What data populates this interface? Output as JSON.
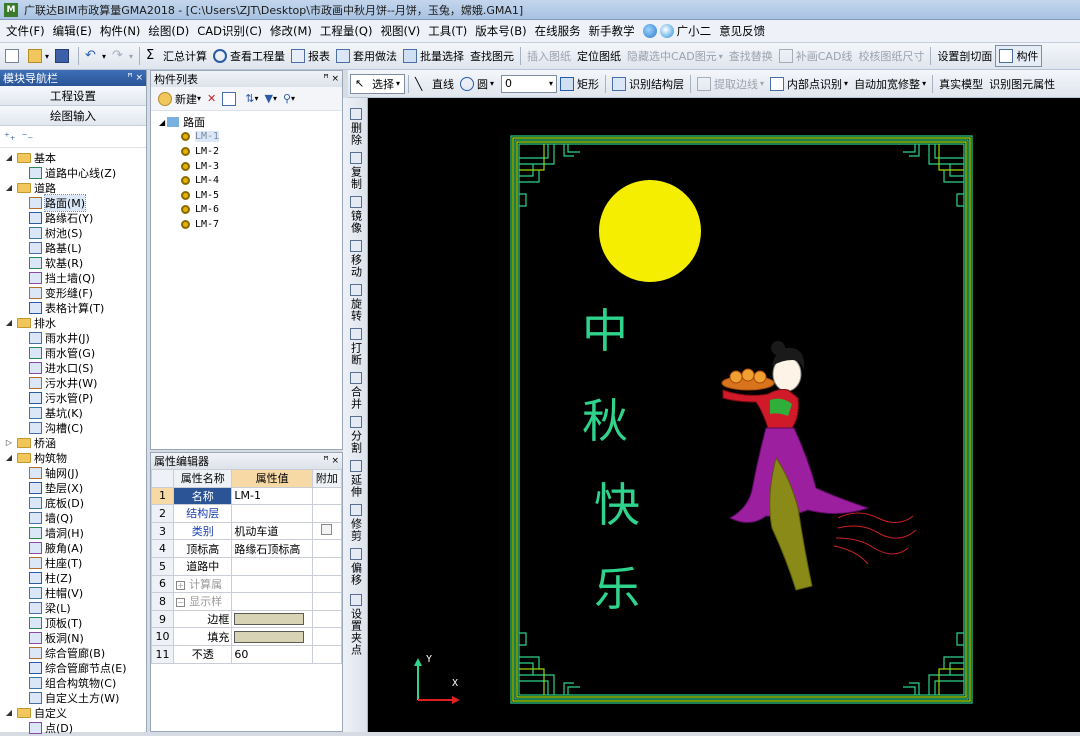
{
  "titlebar": {
    "icon_text": "M",
    "title": "广联达BIM市政算量GMA2018 - [C:\\Users\\ZJT\\Desktop\\市政画中秋月饼--月饼，玉兔，嫦娥.GMA1]"
  },
  "menubar": {
    "items": [
      "文件(F)",
      "编辑(E)",
      "构件(N)",
      "绘图(D)",
      "CAD识别(C)",
      "修改(M)",
      "工程量(Q)",
      "视图(V)",
      "工具(T)",
      "版本号(B)",
      "在线服务",
      "新手教学",
      "广小二",
      "意见反馈"
    ]
  },
  "toolbar1": {
    "summary": "汇总计算",
    "view_qty": "查看工程量",
    "report": "报表",
    "apply_method": "套用做法",
    "batch_select": "批量选择",
    "find_element": "查找图元",
    "insert_drawing": "插入图纸",
    "locate_drawing": "定位图纸",
    "hide_cad": "隐藏选中CAD图元",
    "find_replace": "查找替换",
    "fill_cad_line": "补画CAD线",
    "calibrate_size": "校核图纸尺寸",
    "set_section": "设置剖切面",
    "component": "构件"
  },
  "toolbar2": {
    "select": "选择",
    "line": "直线",
    "circle": "圆",
    "angle_value": "0",
    "rect": "矩形",
    "identify_structure": "识别结构层",
    "extract_edge": "提取边线",
    "inner_point_identify": "内部点识别",
    "auto_widen": "自动加宽修整",
    "real_model": "真实模型",
    "identify_props": "识别图元属性"
  },
  "left_panel": {
    "header": "模块导航栏",
    "pin": "ꟸ ×",
    "btn_project": "工程设置",
    "btn_draw": "绘图输入",
    "tree": [
      {
        "type": "folder",
        "label": "基本",
        "level": 0
      },
      {
        "type": "leaf",
        "label": "道路中心线(Z)",
        "level": 1
      },
      {
        "type": "folder",
        "label": "道路",
        "level": 0
      },
      {
        "type": "leaf",
        "label": "路面(M)",
        "level": 1,
        "selected": true
      },
      {
        "type": "leaf",
        "label": "路缘石(Y)",
        "level": 1
      },
      {
        "type": "leaf",
        "label": "树池(S)",
        "level": 1
      },
      {
        "type": "leaf",
        "label": "路基(L)",
        "level": 1
      },
      {
        "type": "leaf",
        "label": "软基(R)",
        "level": 1
      },
      {
        "type": "leaf",
        "label": "挡土墙(Q)",
        "level": 1
      },
      {
        "type": "leaf",
        "label": "变形缝(F)",
        "level": 1
      },
      {
        "type": "leaf",
        "label": "表格计算(T)",
        "level": 1
      },
      {
        "type": "folder",
        "label": "排水",
        "level": 0
      },
      {
        "type": "leaf",
        "label": "雨水井(J)",
        "level": 1
      },
      {
        "type": "leaf",
        "label": "雨水管(G)",
        "level": 1
      },
      {
        "type": "leaf",
        "label": "进水口(S)",
        "level": 1
      },
      {
        "type": "leaf",
        "label": "污水井(W)",
        "level": 1
      },
      {
        "type": "leaf",
        "label": "污水管(P)",
        "level": 1
      },
      {
        "type": "leaf",
        "label": "基坑(K)",
        "level": 1
      },
      {
        "type": "leaf",
        "label": "沟槽(C)",
        "level": 1
      },
      {
        "type": "folder",
        "label": "桥涵",
        "level": 0,
        "collapsed": true
      },
      {
        "type": "folder",
        "label": "构筑物",
        "level": 0
      },
      {
        "type": "leaf",
        "label": "轴网(J)",
        "level": 1
      },
      {
        "type": "leaf",
        "label": "垫层(X)",
        "level": 1
      },
      {
        "type": "leaf",
        "label": "底板(D)",
        "level": 1
      },
      {
        "type": "leaf",
        "label": "墙(Q)",
        "level": 1
      },
      {
        "type": "leaf",
        "label": "墙洞(H)",
        "level": 1
      },
      {
        "type": "leaf",
        "label": "腋角(A)",
        "level": 1
      },
      {
        "type": "leaf",
        "label": "柱座(T)",
        "level": 1
      },
      {
        "type": "leaf",
        "label": "柱(Z)",
        "level": 1
      },
      {
        "type": "leaf",
        "label": "柱帽(V)",
        "level": 1
      },
      {
        "type": "leaf",
        "label": "梁(L)",
        "level": 1
      },
      {
        "type": "leaf",
        "label": "顶板(T)",
        "level": 1
      },
      {
        "type": "leaf",
        "label": "板洞(N)",
        "level": 1
      },
      {
        "type": "leaf",
        "label": "综合管廊(B)",
        "level": 1
      },
      {
        "type": "leaf",
        "label": "综合管廊节点(E)",
        "level": 1
      },
      {
        "type": "leaf",
        "label": "组合构筑物(C)",
        "level": 1
      },
      {
        "type": "leaf",
        "label": "自定义土方(W)",
        "level": 1
      },
      {
        "type": "folder",
        "label": "自定义",
        "level": 0
      },
      {
        "type": "leaf",
        "label": "点(D)",
        "level": 1
      }
    ]
  },
  "component_list": {
    "header": "构件列表",
    "pin": "ꟸ ×",
    "new_btn": "新建",
    "root": "路面",
    "items": [
      "LM-1",
      "LM-2",
      "LM-3",
      "LM-4",
      "LM-5",
      "LM-6",
      "LM-7"
    ]
  },
  "prop_editor": {
    "header": "属性编辑器",
    "pin": "ꟸ ×",
    "col_name": "属性名称",
    "col_value": "属性值",
    "col_add": "附加",
    "rows": [
      {
        "num": "1",
        "name": "名称",
        "value": "LM-1",
        "style": "blue"
      },
      {
        "num": "2",
        "name": "结构层",
        "value": "",
        "style": "blue"
      },
      {
        "num": "3",
        "name": "类别",
        "value": "机动车道",
        "style": "blue",
        "check": true
      },
      {
        "num": "4",
        "name": "顶标高",
        "value": "路缘石顶标高",
        "style": "normal"
      },
      {
        "num": "5",
        "name": "道路中",
        "value": "",
        "style": "normal"
      },
      {
        "num": "6",
        "name": "计算属",
        "value": "",
        "style": "grey",
        "expander": "+"
      },
      {
        "num": "8",
        "name": "显示样",
        "value": "",
        "style": "grey",
        "expander": "−"
      },
      {
        "num": "9",
        "name": "边框",
        "value": "",
        "style": "normal",
        "swatch": true
      },
      {
        "num": "10",
        "name": "填充",
        "value": "",
        "style": "normal",
        "swatch": true
      },
      {
        "num": "11",
        "name": "不透",
        "value": "60",
        "style": "normal"
      }
    ]
  },
  "vertical_toolbar": {
    "items": [
      "删除",
      "复制",
      "镜像",
      "移动",
      "旋转",
      "打断",
      "合并",
      "分割",
      "延伸",
      "修剪",
      "偏移",
      "设置夹点"
    ]
  },
  "canvas": {
    "text_chars": [
      "中",
      "秋",
      "快",
      "乐"
    ],
    "axis_x": "X",
    "axis_y": "Y",
    "colors": {
      "background": "#000000",
      "frame": "#2fd38c",
      "frame_inner": "#9ed60a",
      "moon": "#f5ee00",
      "text": "#2fd38c"
    }
  }
}
